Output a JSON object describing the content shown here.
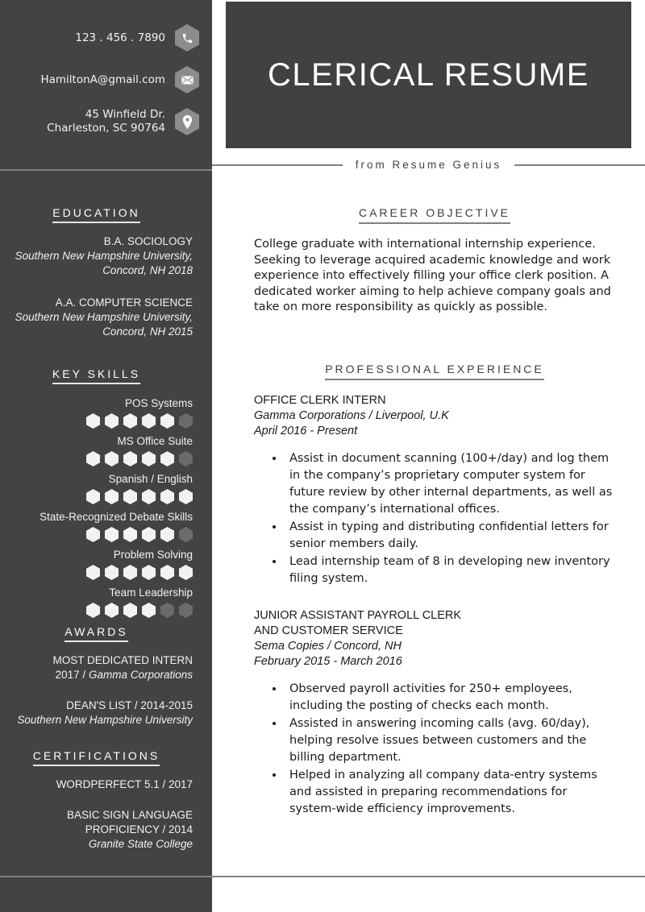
{
  "header": {
    "title": "CLERICAL RESUME",
    "tagline": "from Resume Genius"
  },
  "contact": {
    "items": [
      {
        "icon": "phone-icon",
        "text": "123 . 456 . 7890"
      },
      {
        "icon": "email-icon",
        "text": "HamiltonA@gmail.com"
      },
      {
        "icon": "map-pin-icon",
        "text": "45 Winfield Dr.\nCharleston, SC 90764"
      }
    ]
  },
  "sidebar": {
    "education": {
      "heading": "EDUCATION",
      "entries": [
        {
          "degree": "B.A. SOCIOLOGY",
          "school": "Southern New Hampshire\nUniversity, Concord, NH\n2018"
        },
        {
          "degree": "A.A. COMPUTER SCIENCE",
          "school": "Southern New Hampshire\nUniversity, Concord, NH\n2015"
        }
      ]
    },
    "skills": {
      "heading": "KEY SKILLS",
      "max": 6,
      "items": [
        {
          "name": "POS Systems",
          "level": 5
        },
        {
          "name": "MS Office Suite",
          "level": 5
        },
        {
          "name": "Spanish / English",
          "level": 6
        },
        {
          "name": "State-Recognized Debate Skills",
          "level": 5
        },
        {
          "name": "Problem Solving",
          "level": 6
        },
        {
          "name": "Team Leadership",
          "level": 4
        }
      ]
    },
    "awards": {
      "heading": "AWARDS",
      "entries": [
        {
          "title": "MOST DEDICATED INTERN",
          "detail_plain": "2017 / ",
          "detail_italic": "Gamma Corporations"
        },
        {
          "title": "DEAN'S LIST / 2014-2015",
          "detail_plain": "",
          "detail_italic": "Southern New Hampshire\nUniversity"
        }
      ]
    },
    "certifications": {
      "heading": "CERTIFICATIONS",
      "entries": [
        {
          "title": "WORDPERFECT 5.1 / 2017",
          "detail_italic": ""
        },
        {
          "title": "BASIC SIGN LANGUAGE\nPROFICIENCY / 2014",
          "detail_italic": "Granite State College"
        }
      ]
    }
  },
  "main": {
    "objective": {
      "heading": "CAREER OBJECTIVE",
      "text": "College graduate with international internship experience. Seeking to leverage acquired academic knowledge and work experience into effectively filling your office clerk position. A dedicated worker aiming to help achieve company goals and take on more responsibility as quickly as possible."
    },
    "experience": {
      "heading": "PROFESSIONAL EXPERIENCE",
      "jobs": [
        {
          "title": "OFFICE CLERK INTERN",
          "company": "Gamma Corporations / Liverpool, U.K",
          "dates": "April 2016 - Present",
          "bullets": [
            "Assist in document scanning (100+/day) and log them in the company’s proprietary computer system for future review by other internal departments, as well as the company’s international offices.",
            "Assist in typing and distributing confidential letters for senior members daily.",
            "Lead internship team of 8 in developing new inventory filing system."
          ]
        },
        {
          "title": "JUNIOR ASSISTANT PAYROLL CLERK\nAND CUSTOMER SERVICE",
          "company": "Sema Copies / Concord, NH",
          "dates": "February 2015 - March 2016",
          "bullets": [
            "Observed payroll activities for 250+ employees, including the posting of checks each month.",
            "Assisted in answering incoming calls (avg. 60/day), helping resolve issues between customers and the billing department.",
            "Helped in analyzing all company data-entry systems and assisted in preparing recommendations for system-wide efficiency improvements."
          ]
        }
      ]
    }
  },
  "colors": {
    "sidebar_bg": "#434343",
    "title_band_bg": "#414141",
    "rule": "#808080",
    "badge": "#8c8c8c",
    "dot_on": "#f2f2f2",
    "dot_off": "#6b6b6b",
    "text_light": "#f2f2f2",
    "text_dark": "#1a1a1a"
  }
}
